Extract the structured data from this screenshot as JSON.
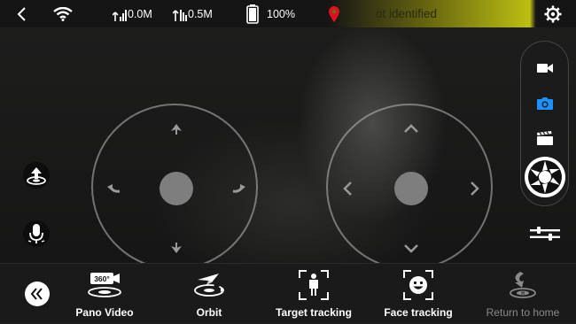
{
  "status_bar": {
    "upload_speed": "0.0M",
    "download_speed": "0.5M",
    "battery": "100%",
    "location": "ot identified"
  },
  "bottom_bar": {
    "modes": [
      {
        "label": "Pano Video",
        "icon": "pano-video-icon",
        "badge": "360°"
      },
      {
        "label": "Orbit",
        "icon": "orbit-icon"
      },
      {
        "label": "Target tracking",
        "icon": "target-tracking-icon"
      },
      {
        "label": "Face tracking",
        "icon": "face-tracking-icon"
      },
      {
        "label": "Return to home",
        "icon": "return-home-icon",
        "disabled": true
      }
    ]
  },
  "colors": {
    "accent": "#1e90ff",
    "location_pin": "#e01020",
    "status_highlight": "#bcbf12"
  }
}
